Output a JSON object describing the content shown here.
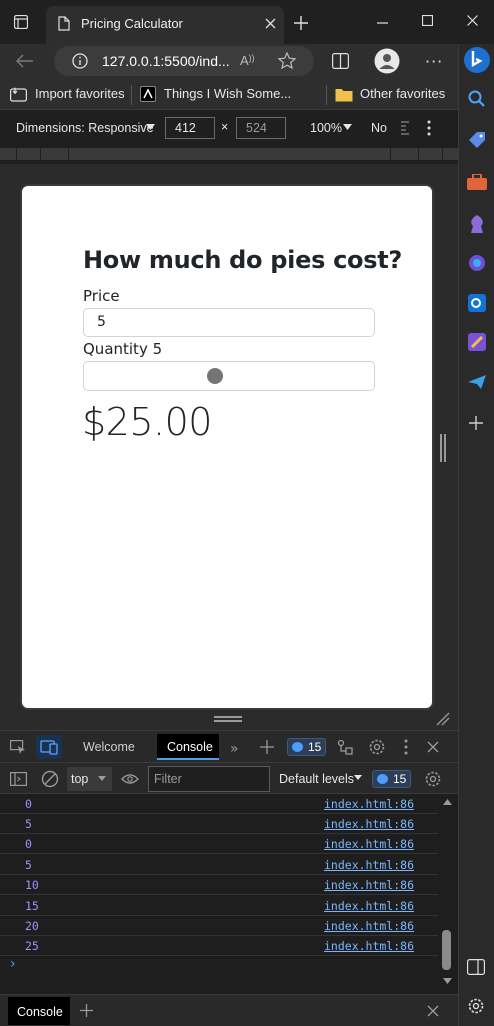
{
  "browser": {
    "tab_title": "Pricing Calculator",
    "url": "127.0.0.1:5500/ind...",
    "favorites": [
      "Import favorites",
      "Things I Wish Some...",
      "Other favorites"
    ]
  },
  "device_toolbar": {
    "dimensions_label": "Dimensions: Responsive",
    "width": "412",
    "height": "524",
    "zoom": "100%",
    "throttle": "No"
  },
  "page": {
    "heading": "How much do pies cost?",
    "price_label": "Price",
    "price_value": "5",
    "quantity_label": "Quantity 5",
    "quantity_fraction": 0.45,
    "total": "$25.00"
  },
  "devtools": {
    "tabs": {
      "welcome": "Welcome",
      "console": "Console"
    },
    "issues_count": "15",
    "context": "top",
    "filter_placeholder": "Filter",
    "levels": "Default levels",
    "levels_count": "15",
    "logs": [
      {
        "value": "0",
        "source": "index.html:86"
      },
      {
        "value": "5",
        "source": "index.html:86"
      },
      {
        "value": "0",
        "source": "index.html:86"
      },
      {
        "value": "5",
        "source": "index.html:86"
      },
      {
        "value": "10",
        "source": "index.html:86"
      },
      {
        "value": "15",
        "source": "index.html:86"
      },
      {
        "value": "20",
        "source": "index.html:86"
      },
      {
        "value": "25",
        "source": "index.html:86"
      }
    ],
    "prompt": "›",
    "drawer_tab": "Console"
  }
}
